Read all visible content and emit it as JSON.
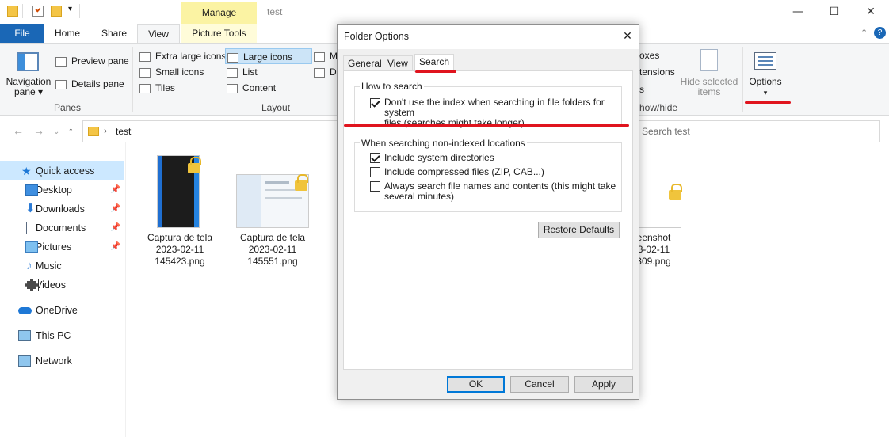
{
  "window": {
    "title": "test",
    "manage_label": "Manage",
    "controls": {
      "minimize": "—",
      "maximize": "☐",
      "close": "✕"
    },
    "help_icon": "?"
  },
  "tabs": {
    "file": "File",
    "home": "Home",
    "share": "Share",
    "view": "View",
    "picture_tools": "Picture Tools"
  },
  "ribbon": {
    "panes": {
      "navigation_pane": "Navigation\npane ▾",
      "navigation_pane_line1": "Navigation",
      "navigation_pane_line2": "pane ▾",
      "preview_pane": "Preview pane",
      "details_pane": "Details pane",
      "group_label": "Panes"
    },
    "layout": {
      "extra_large_icons": "Extra large icons",
      "large_icons": "Large icons",
      "small_icons": "Small icons",
      "list": "List",
      "tiles": "Tiles",
      "content": "Content",
      "cut_m": "M",
      "cut_d": "D",
      "group_label": "Layout"
    },
    "show_hide": {
      "boxes": "oxes",
      "extensions": "tensions",
      "items": "s",
      "hide_selected_line1": "Hide selected",
      "hide_selected_line2": "items",
      "group_label": "how/hide"
    },
    "options": {
      "label": "Options",
      "arrow": "▾"
    }
  },
  "address": {
    "path_separator": "›",
    "folder": "test",
    "search_placeholder": "Search test"
  },
  "nav_pane": {
    "items": [
      {
        "label": "Quick access",
        "icon": "star-icon",
        "pinned": false
      },
      {
        "label": "Desktop",
        "icon": "desktop-icon",
        "pinned": true
      },
      {
        "label": "Downloads",
        "icon": "download-icon",
        "pinned": true
      },
      {
        "label": "Documents",
        "icon": "documents-icon",
        "pinned": true
      },
      {
        "label": "Pictures",
        "icon": "pictures-icon",
        "pinned": true
      },
      {
        "label": "Music",
        "icon": "music-icon",
        "pinned": false
      },
      {
        "label": "Videos",
        "icon": "videos-icon",
        "pinned": false
      },
      {
        "label": "OneDrive",
        "icon": "cloud-icon",
        "pinned": false
      },
      {
        "label": "This PC",
        "icon": "computer-icon",
        "pinned": false
      },
      {
        "label": "Network",
        "icon": "network-icon",
        "pinned": false
      }
    ],
    "pin_glyph": "📌"
  },
  "files": [
    {
      "line1": "Captura de tela",
      "line2": "2023-02-11",
      "line3": "145423.png"
    },
    {
      "line1": "Captura de tela",
      "line2": "2023-02-11",
      "line3": "145551.png"
    },
    {
      "line1": "eenshot",
      "line2": "3-02-11",
      "line3": "309.png"
    }
  ],
  "dialog": {
    "title": "Folder Options",
    "close": "✕",
    "tabs": {
      "general": "General",
      "view": "View",
      "search": "Search"
    },
    "how_to_search": {
      "label": "How to search",
      "option1_line1": "Don't use the index when searching in file folders for system",
      "option1_line2": "files (searches might take longer)",
      "option1_checked": true
    },
    "non_indexed": {
      "label": "When searching non-indexed locations",
      "include_system": "Include system directories",
      "include_system_checked": true,
      "include_compressed": "Include compressed files (ZIP, CAB...)",
      "include_compressed_checked": false,
      "always_search_line1": "Always search file names and contents (this might take",
      "always_search_line2": "several minutes)",
      "always_search_checked": false
    },
    "restore_defaults": "Restore Defaults",
    "ok": "OK",
    "cancel": "Cancel",
    "apply": "Apply"
  },
  "colors": {
    "file_tab": "#1a67b6",
    "manage_tab": "#fbf3a3",
    "selection": "#cce8ff",
    "annotation_red": "#e0141e",
    "default_button_border": "#0078d7"
  }
}
